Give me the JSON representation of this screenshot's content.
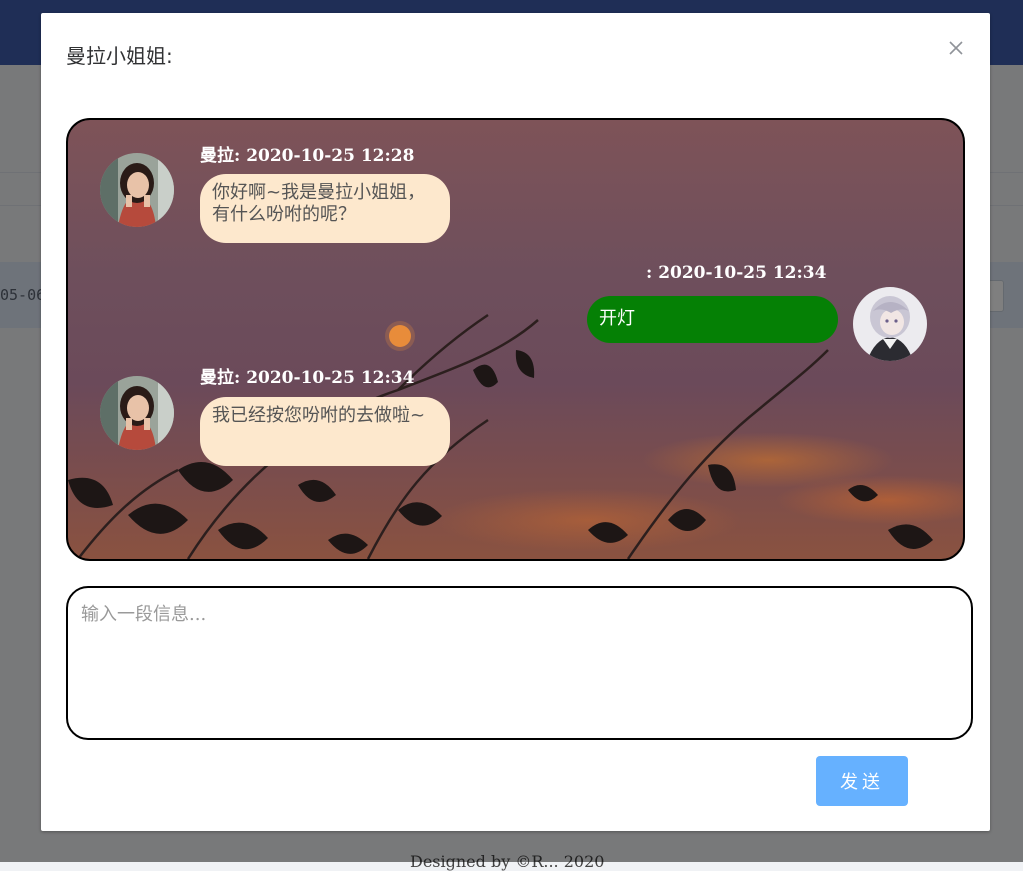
{
  "dialog": {
    "title": "曼拉小姐姐:",
    "close_icon": "close-icon"
  },
  "messages": [
    {
      "sender": "bot",
      "meta": "曼拉: 2020-10-25 12:28",
      "text": "你好啊~我是曼拉小姐姐，有什么吩咐的呢？",
      "avatar": "woman-avatar"
    },
    {
      "sender": "me",
      "meta": ": 2020-10-25 12:34",
      "text": "开灯",
      "avatar": "anime-boy-avatar"
    },
    {
      "sender": "bot",
      "meta": "曼拉: 2020-10-25 12:34",
      "text": "我已经按您吩咐的去做啦~",
      "avatar": "woman-avatar"
    }
  ],
  "input": {
    "placeholder": "输入一段信息...",
    "value": ""
  },
  "send_button": {
    "label": "发送"
  },
  "background_page": {
    "row_text": "05-06",
    "footer_text": "Designed by ©R... 2020"
  },
  "colors": {
    "header": "#3f5cac",
    "send_button": "#66b1ff",
    "bot_bubble": "#fde8cd",
    "user_bubble": "#058005"
  }
}
